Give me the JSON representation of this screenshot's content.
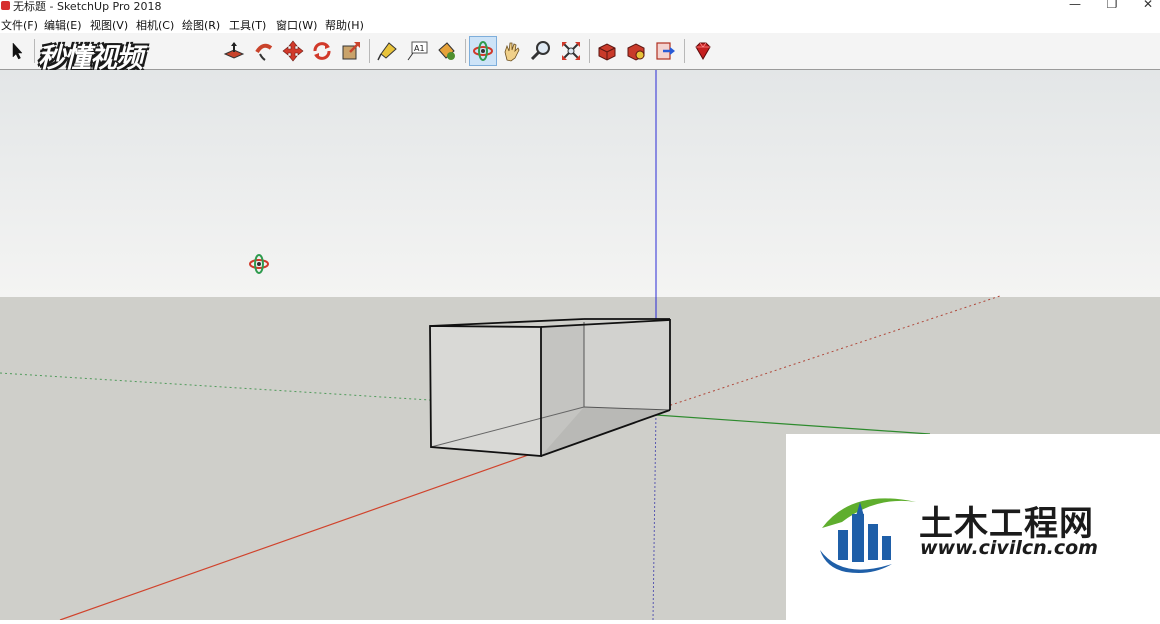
{
  "window": {
    "title": "无标题 - SketchUp Pro 2018",
    "minimize_glyph": "—",
    "restore_glyph": "❐",
    "close_glyph": "✕"
  },
  "menu": {
    "items": [
      {
        "label": "文件(F)"
      },
      {
        "label": "编辑(E)"
      },
      {
        "label": "视图(V)"
      },
      {
        "label": "相机(C)"
      },
      {
        "label": "绘图(R)"
      },
      {
        "label": "工具(T)"
      },
      {
        "label": "窗口(W)"
      },
      {
        "label": "帮助(H)"
      }
    ]
  },
  "toolbar": {
    "tools": [
      {
        "name": "select-tool-icon"
      },
      {
        "name": "push-pull-tool-icon"
      },
      {
        "name": "follow-me-tool-icon"
      },
      {
        "name": "move-tool-icon"
      },
      {
        "name": "rotate-tool-icon"
      },
      {
        "name": "scale-tool-icon"
      },
      {
        "name": "tape-measure-tool-icon"
      },
      {
        "name": "text-tool-icon"
      },
      {
        "name": "paint-bucket-tool-icon"
      },
      {
        "name": "orbit-tool-icon",
        "active": true
      },
      {
        "name": "pan-tool-icon"
      },
      {
        "name": "zoom-tool-icon"
      },
      {
        "name": "zoom-extents-tool-icon"
      },
      {
        "name": "3d-warehouse-icon"
      },
      {
        "name": "extension-warehouse-icon"
      },
      {
        "name": "send-to-layout-icon"
      },
      {
        "name": "ruby-console-icon"
      }
    ],
    "text_tool_label": "A1"
  },
  "watermarks": {
    "top_left": "秒懂视频",
    "bottom_right_cn": "土木工程网",
    "bottom_right_url": "www.civilcn.com"
  },
  "colors": {
    "sky_top": "#e4e7e8",
    "sky_bottom": "#f3f3f3",
    "ground": "#cfcfca",
    "red_axis": "#d0432c",
    "green_axis": "#2e8b2e",
    "blue_axis": "#2a2ad6",
    "logo_blue": "#1f5fa8",
    "logo_green": "#5fae2e"
  }
}
